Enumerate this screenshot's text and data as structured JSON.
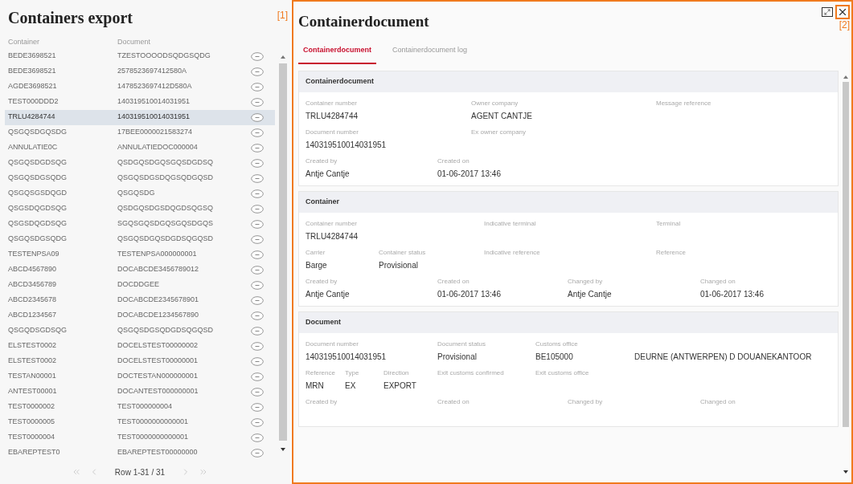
{
  "list_panel": {
    "title": "Containers export",
    "annotation": "[1]",
    "columns": [
      "Container",
      "Document"
    ],
    "rows": [
      {
        "container": "BEDE3698521",
        "document": "TZESTOOOODSQDGSQDG",
        "selected": false
      },
      {
        "container": "BEDE3698521",
        "document": "2578523697412580A",
        "selected": false
      },
      {
        "container": "AGDE3698521",
        "document": "1478523697412D580A",
        "selected": false
      },
      {
        "container": "TEST000DDD2",
        "document": "140319510014031951",
        "selected": false
      },
      {
        "container": "TRLU4284744",
        "document": "140319510014031951",
        "selected": true
      },
      {
        "container": "QSGQSDGQSDG",
        "document": "17BEE0000021583274",
        "selected": false
      },
      {
        "container": "ANNULATIE0C",
        "document": "ANNULATIEDOC000004",
        "selected": false
      },
      {
        "container": "QSGQSDGDSQG",
        "document": "QSDGQSDGQSGQSDGDSQ",
        "selected": false
      },
      {
        "container": "QSGQSDGSQDG",
        "document": "QSGQSDGSDQGSQDGQSD",
        "selected": false
      },
      {
        "container": "QSGQSGSDQGD",
        "document": "QSGQSDG",
        "selected": false
      },
      {
        "container": "QSGSDQGDSQG",
        "document": "QSDGQSDGSDQGDSQGSQ",
        "selected": false
      },
      {
        "container": "QSGSDQGDSQG",
        "document": "SGQSGQSDGQSGQSDGQS",
        "selected": false
      },
      {
        "container": "QSGQSDGSQDG",
        "document": "QSGQSDGQSDGDSQGQSD",
        "selected": false
      },
      {
        "container": "TESTENPSA09",
        "document": "TESTENPSA000000001",
        "selected": false
      },
      {
        "container": "ABCD4567890",
        "document": "DOCABCDE3456789012",
        "selected": false
      },
      {
        "container": "ABCD3456789",
        "document": "DOCDDGEE",
        "selected": false
      },
      {
        "container": "ABCD2345678",
        "document": "DOCABCDE2345678901",
        "selected": false
      },
      {
        "container": "ABCD1234567",
        "document": "DOCABCDE1234567890",
        "selected": false
      },
      {
        "container": "QSGQDSGDSQG",
        "document": "QSGQSDGSQDGDSQGQSD",
        "selected": false
      },
      {
        "container": "ELSTEST0002",
        "document": "DOCELSTEST00000002",
        "selected": false
      },
      {
        "container": "ELSTEST0002",
        "document": "DOCELSTEST00000001",
        "selected": false
      },
      {
        "container": "TESTAN00001",
        "document": "DOCTESTAN000000001",
        "selected": false
      },
      {
        "container": "ANTEST00001",
        "document": "DOCANTEST000000001",
        "selected": false
      },
      {
        "container": "TEST0000002",
        "document": "TEST000000004",
        "selected": false
      },
      {
        "container": "TEST0000005",
        "document": "TEST0000000000001",
        "selected": false
      },
      {
        "container": "TEST0000004",
        "document": "TEST0000000000001",
        "selected": false
      },
      {
        "container": "EBAREPTEST0",
        "document": "EBAREPTEST00000000",
        "selected": false
      }
    ],
    "pager": {
      "label": "Row 1-31 / 31",
      "buttons": [
        {
          "kind": "first",
          "disabled": true
        },
        {
          "kind": "prev",
          "disabled": true
        },
        {
          "kind": "next",
          "disabled": true
        },
        {
          "kind": "last",
          "disabled": true
        }
      ]
    }
  },
  "detail_panel": {
    "title": "Containerdocument",
    "annotation": "[2]",
    "tabs": [
      {
        "label": "Containerdocument",
        "selected": true
      },
      {
        "label": "Containerdocument log",
        "selected": false
      }
    ],
    "sections": [
      {
        "title": "Containerdocument",
        "rows": [
          {
            "fields": [
              {
                "label": "Container number",
                "value": "TRLU4284744"
              },
              {
                "label": "Owner company",
                "value": "AGENT CANTJE"
              },
              {
                "label": "Message reference"
              }
            ]
          },
          {
            "fields": [
              {
                "label": "Document number",
                "value": "140319510014031951"
              },
              {
                "label": "Ex owner company"
              }
            ]
          },
          {
            "fields": [
              {
                "label": "Created by",
                "value": "Antje Cantje"
              },
              {
                "label": "Created on",
                "value": "01-06-2017 13:46"
              }
            ]
          }
        ]
      },
      {
        "title": "Container",
        "rows": [
          {
            "fields": [
              {
                "label": "Container number",
                "value": "TRLU4284744"
              },
              {
                "label": "Indicative terminal"
              },
              {
                "label": "Terminal"
              }
            ]
          },
          {
            "fields": [
              {
                "label": "Carrier",
                "value": "Barge"
              },
              {
                "label": "Container status",
                "value": "Provisional"
              },
              {
                "label": "Indicative reference"
              },
              {
                "label": "Reference"
              }
            ]
          },
          {
            "fields": [
              {
                "label": "Created by",
                "value": "Antje Cantje"
              },
              {
                "label": "Created on",
                "value": "01-06-2017 13:46"
              },
              {
                "label": "Changed by",
                "value": "Antje Cantje"
              },
              {
                "label": "Changed on",
                "value": "01-06-2017 13:46"
              }
            ]
          }
        ]
      },
      {
        "title": "Document",
        "rows": [
          {
            "fields": [
              {
                "label": "Document number",
                "value": "140319510014031951"
              },
              {
                "label": "Document status",
                "value": "Provisional"
              },
              {
                "label": "Customs office",
                "value": "BE105000"
              },
              {
                "value": "DEURNE (ANTWERPEN) D DOUANEKANTOOR"
              }
            ]
          },
          {
            "fields": [
              {
                "label": "Reference",
                "value": "MRN"
              },
              {
                "label": "Type",
                "value": "EX"
              },
              {
                "label": "Direction",
                "value": "EXPORT"
              },
              {
                "label": "Exit customs confirmed"
              },
              {
                "label": "Exit customs office"
              }
            ]
          },
          {
            "fields": [
              {
                "label": "Created by"
              },
              {
                "label": "Created on"
              },
              {
                "label": "Changed by"
              },
              {
                "label": "Changed on"
              }
            ]
          }
        ]
      }
    ]
  }
}
